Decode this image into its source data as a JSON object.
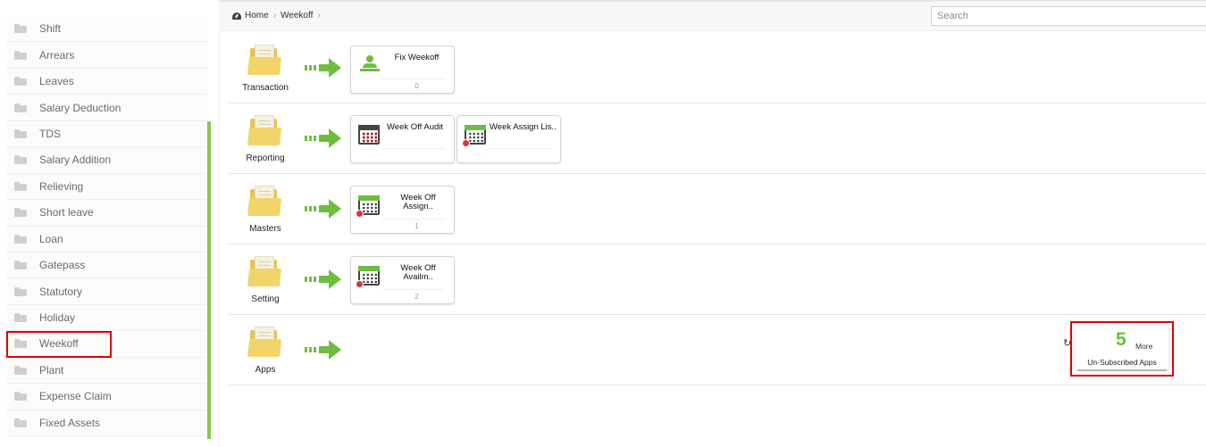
{
  "sidebar": {
    "items": [
      {
        "label": "Shift"
      },
      {
        "label": "Arrears"
      },
      {
        "label": "Leaves"
      },
      {
        "label": "Salary Deduction"
      },
      {
        "label": "TDS"
      },
      {
        "label": "Salary Addition"
      },
      {
        "label": "Relieving"
      },
      {
        "label": "Short leave"
      },
      {
        "label": "Loan"
      },
      {
        "label": "Gatepass"
      },
      {
        "label": "Statutory"
      },
      {
        "label": "Holiday"
      },
      {
        "label": "Weekoff"
      },
      {
        "label": "Plant"
      },
      {
        "label": "Expense Claim"
      },
      {
        "label": "Fixed Assets"
      }
    ],
    "selected": "Weekoff"
  },
  "breadcrumb": {
    "home": "Home",
    "current": "Weekoff",
    "sep": "›"
  },
  "search": {
    "placeholder": "Search",
    "value": ""
  },
  "rows": {
    "transaction": {
      "label": "Transaction",
      "cards": [
        {
          "title": "Fix Weekoff",
          "count": "0",
          "icon": "person-icon"
        }
      ]
    },
    "reporting": {
      "label": "Reporting",
      "cards": [
        {
          "title": "Week Off Audit",
          "count": "",
          "icon": "calendar-icon"
        },
        {
          "title": "Week Assign Lis..",
          "count": "",
          "icon": "calendar-icon"
        }
      ]
    },
    "masters": {
      "label": "Masters",
      "cards": [
        {
          "title": "Week Off Assign..",
          "count": "1",
          "icon": "calendar-icon"
        }
      ]
    },
    "setting": {
      "label": "Setting",
      "cards": [
        {
          "title": "Week Off Availm..",
          "count": "2",
          "icon": "calendar-icon"
        }
      ]
    },
    "apps": {
      "label": "Apps"
    }
  },
  "apps_more": {
    "count": "5",
    "more_label": "More",
    "sub_label": "Un-Subscribed Apps",
    "refresh_icon": "↻"
  },
  "colors": {
    "accent_green": "#6fbd3f",
    "folder_yellow": "#f3d46a",
    "highlight_red": "#e00000"
  }
}
